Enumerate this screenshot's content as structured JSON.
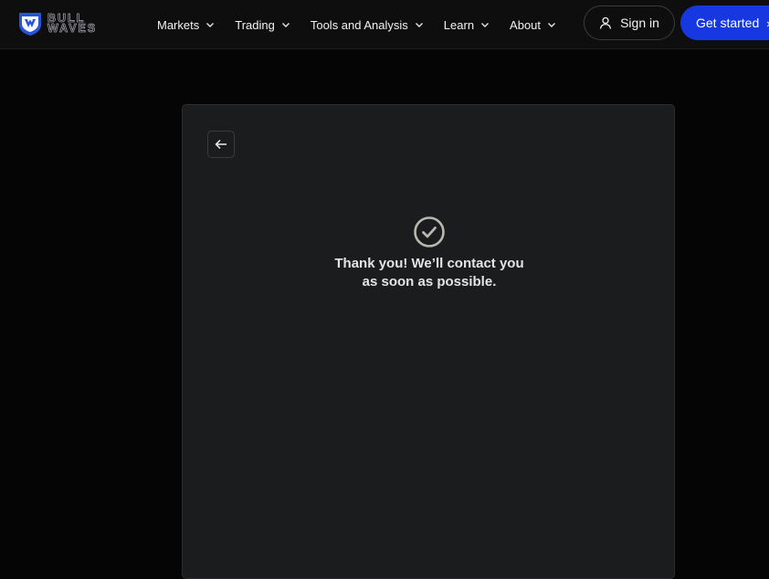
{
  "brand": {
    "logo_line1": "BULL",
    "logo_line2": "WAVES"
  },
  "nav": {
    "items": [
      {
        "label": "Markets"
      },
      {
        "label": "Trading"
      },
      {
        "label": "Tools and Analysis"
      },
      {
        "label": "Learn"
      },
      {
        "label": "About"
      }
    ]
  },
  "header_actions": {
    "sign_in_label": "Sign in",
    "get_started_label": "Get started",
    "get_started_icon": "arrow-right-icon",
    "sign_in_icon": "user-icon"
  },
  "confirmation": {
    "back_icon": "arrow-left-icon",
    "status_icon": "check-circle-icon",
    "line1": "Thank you! We’ll contact you",
    "line2": "as soon as possible."
  },
  "colors": {
    "background": "#050505",
    "header": "#0e0e0f",
    "panel": "#1b1c1e",
    "accent": "#1738e0",
    "check": "#b9b7b0"
  }
}
